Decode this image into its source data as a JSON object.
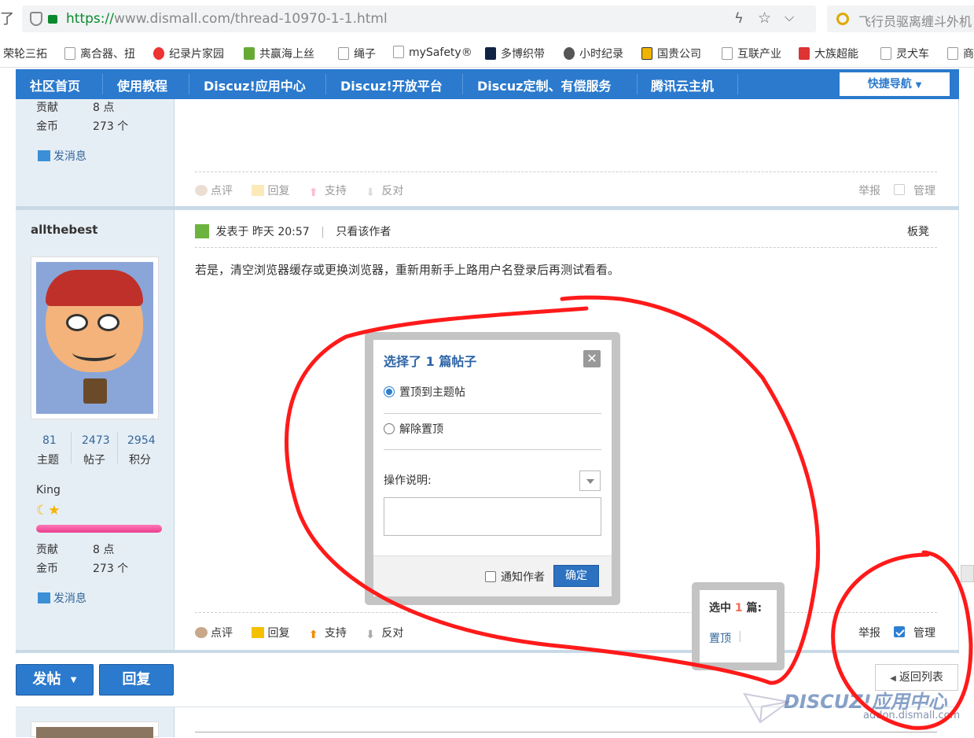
{
  "browser": {
    "url_scheme": "https://",
    "url_rest": "www.dismall.com/thread-10970-1-1.html",
    "search_text": "飞行员驱离缠斗外机",
    "bookmarks": [
      "荣轮三拓",
      "离合器、扭",
      "纪录片家园",
      "共赢海上丝",
      "绳子",
      "mySafety®",
      "多博织带",
      "小时纪录",
      "国贵公司",
      "互联产业",
      "大族超能",
      "灵犬车",
      "商"
    ]
  },
  "nav": {
    "items": [
      "社区首页",
      "使用教程",
      "Discuz!应用中心",
      "Discuz!开放平台",
      "Discuz定制、有偿服务",
      "腾讯云主机"
    ],
    "quick_nav": "快捷导航"
  },
  "post_prev": {
    "contrib_label": "贡献",
    "contrib_value": "8 点",
    "gold_label": "金币",
    "gold_value": "273 个",
    "send_msg": "发消息",
    "actions": {
      "rate": "点评",
      "reply": "回复",
      "support": "支持",
      "oppose": "反对",
      "report": "举报",
      "manage": "管理"
    }
  },
  "post": {
    "author": "allthebest",
    "posted_at": "发表于 昨天 20:57",
    "author_only": "只看该作者",
    "floor": "板凳",
    "content": "若是，清空浏览器缓存或更换浏览器，重新用新手上路用户名登录后再测试看看。",
    "stats": [
      {
        "value": "81",
        "label": "主题"
      },
      {
        "value": "2473",
        "label": "帖子"
      },
      {
        "value": "2954",
        "label": "积分"
      }
    ],
    "group": "King",
    "contrib_label": "贡献",
    "contrib_value": "8 点",
    "gold_label": "金币",
    "gold_value": "273 个",
    "send_msg": "发消息",
    "actions": {
      "rate": "点评",
      "reply": "回复",
      "support": "支持",
      "oppose": "反对",
      "report": "举报",
      "manage": "管理"
    },
    "manage_checked": true
  },
  "dialog": {
    "title_prefix": "选择了",
    "title_count": "1",
    "title_suffix": "篇帖子",
    "option_stick": "置顶到主题帖",
    "option_unstick": "解除置顶",
    "reason_label": "操作说明:",
    "reason_value": "",
    "notify_author": "通知作者",
    "confirm": "确定"
  },
  "selection": {
    "label_prefix": "选中",
    "count": "1",
    "label_suffix": "篇:",
    "action": "置顶",
    "sep": "|"
  },
  "bottom": {
    "post_btn": "发帖",
    "reply_btn": "回复",
    "back_to_list": "返回列表"
  },
  "watermark": {
    "brand": "DISCUZ!应用中心",
    "domain": "addon.dismall.com"
  },
  "colors": {
    "nav_blue": "#2b7acd",
    "annotation_red": "#ff1a1a",
    "sidebar_bg": "#e6eef5"
  }
}
